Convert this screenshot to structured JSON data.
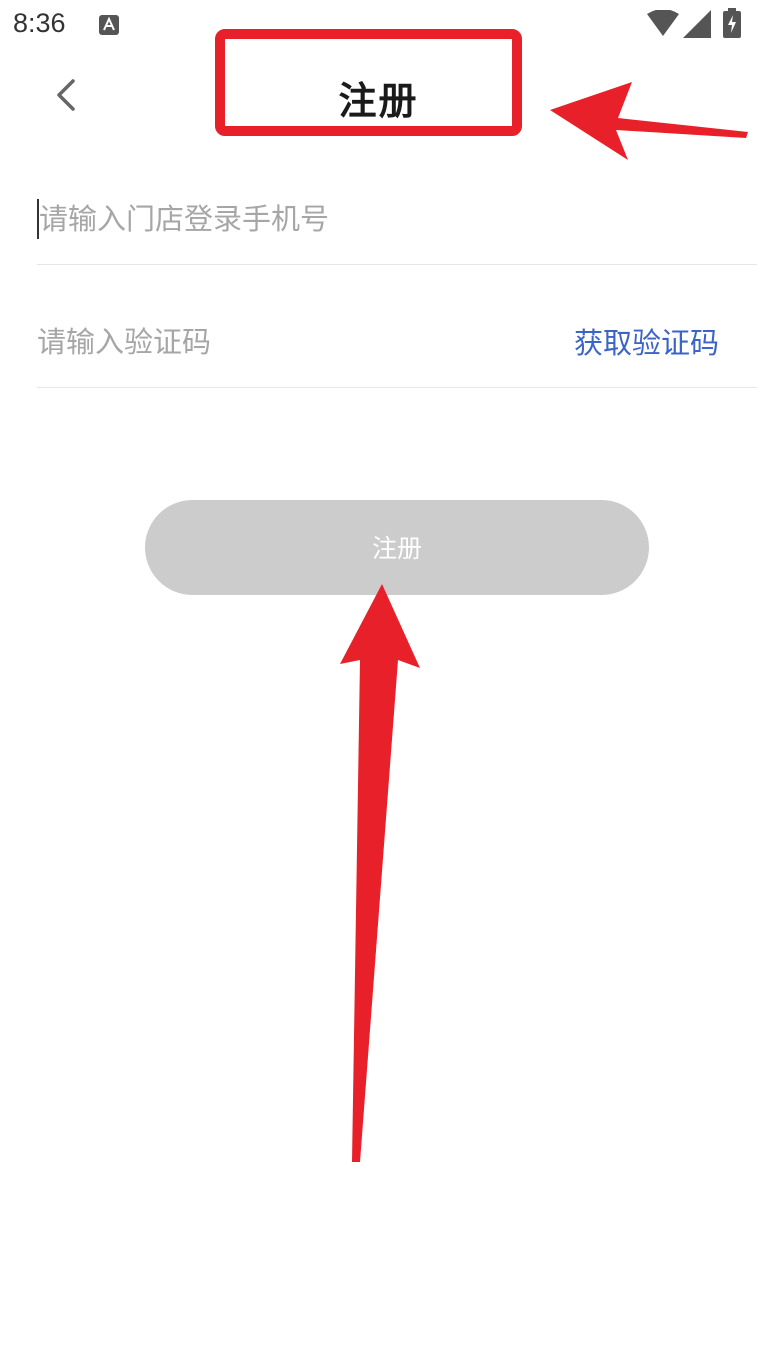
{
  "status_bar": {
    "time": "8:36",
    "app_icon": "font-a-icon",
    "icons": [
      "wifi-icon",
      "signal-icon",
      "battery-charging-icon"
    ]
  },
  "header": {
    "back_icon": "chevron-left-icon",
    "title": "注册"
  },
  "form": {
    "phone_placeholder": "请输入门店登录手机号",
    "phone_value": "",
    "code_placeholder": "请输入验证码",
    "code_value": "",
    "get_code_label": "获取验证码"
  },
  "register_button_label": "注册",
  "colors": {
    "annotation_red": "#e8202a",
    "link_blue": "#3a64c8",
    "button_disabled_gray": "#cccccc"
  }
}
